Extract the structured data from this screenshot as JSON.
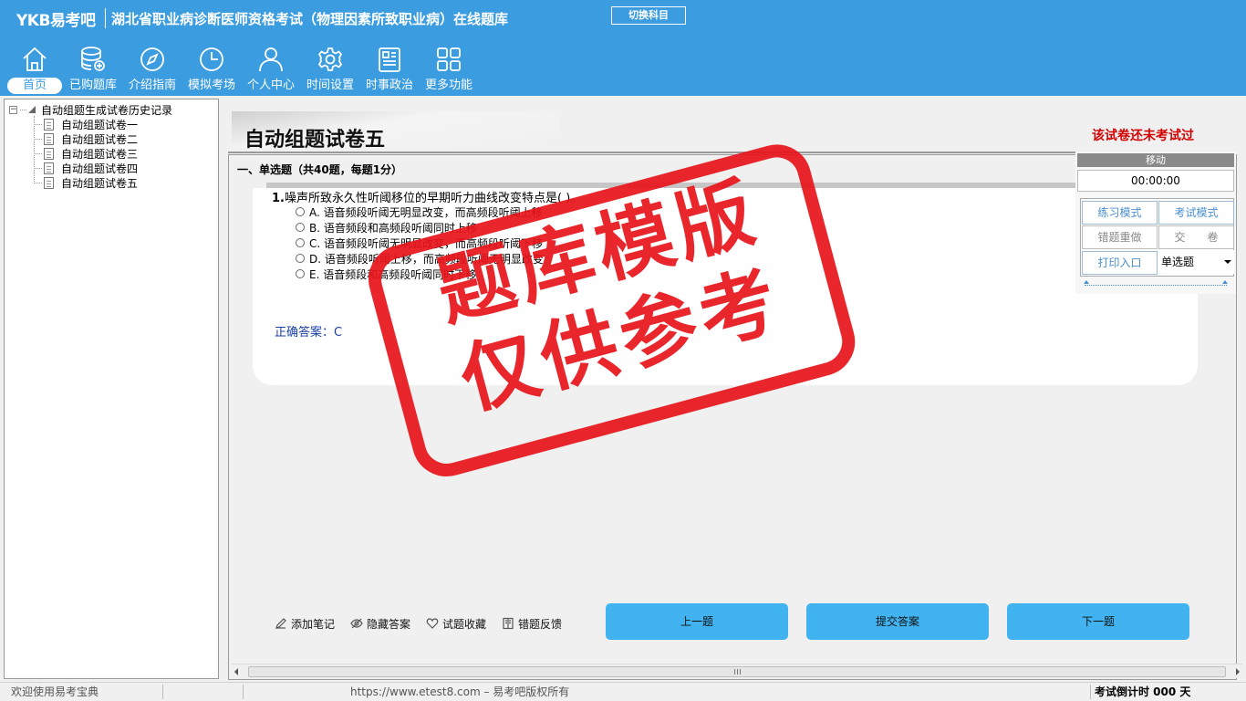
{
  "header": {
    "logo": "YKB易考吧",
    "title": "湖北省职业病诊断医师资格考试（物理因素所致职业病）在线题库",
    "switch_label": "切换科目"
  },
  "nav": [
    {
      "label": "首页",
      "icon": "home-icon"
    },
    {
      "label": "已购题库",
      "icon": "database-icon"
    },
    {
      "label": "介绍指南",
      "icon": "compass-icon"
    },
    {
      "label": "模拟考场",
      "icon": "clock-icon"
    },
    {
      "label": "个人中心",
      "icon": "user-icon"
    },
    {
      "label": "时间设置",
      "icon": "gear-icon"
    },
    {
      "label": "时事政治",
      "icon": "newspaper-icon"
    },
    {
      "label": "更多功能",
      "icon": "grid-icon"
    }
  ],
  "tree": {
    "root": "自动组题生成试卷历史记录",
    "items": [
      "自动组题试卷一",
      "自动组题试卷二",
      "自动组题试卷三",
      "自动组题试卷四",
      "自动组题试卷五"
    ]
  },
  "paper": {
    "title": "自动组题试卷五",
    "status": "该试卷还未考试过",
    "section": "一、单选题（共40题，每题1分）"
  },
  "question": {
    "number": "1.",
    "stem": "噪声所致永久性听阈移位的早期听力曲线改变特点是( )。",
    "options": [
      "A. 语音频段听阈无明显改变，而高频段听阈上移",
      "B. 语音频段和高频段听阈同时上移",
      "C. 语音频段听阈无明显改变，而高频段听阈下移",
      "D. 语音频段听阈上移，而高频段听阈无明显改变",
      "E. 语音频段和高频段听阈同时下移"
    ],
    "answer": "正确答案：C"
  },
  "control": {
    "move": "移动",
    "timer": "00:00:00",
    "practice": "练习模式",
    "exam": "考试模式",
    "redo": "错题重做",
    "submit": "交　　卷",
    "print": "打印入口",
    "type_select": "单选题"
  },
  "tools": {
    "note": "添加笔记",
    "hide": "隐藏答案",
    "fav": "试题收藏",
    "feedback": "错题反馈"
  },
  "actions": {
    "prev": "上一题",
    "submit": "提交答案",
    "next": "下一题"
  },
  "statusbar": {
    "welcome": "欢迎使用易考宝典",
    "site": "https://www.etest8.com – 易考吧版权所有",
    "countdown": "考试倒计时 000 天"
  },
  "watermark": {
    "line1": "题库模版",
    "line2": "仅供参考"
  },
  "colors": {
    "header": "#3b9de0",
    "primary_button": "#40b3f0",
    "stamp": "#e8141b",
    "status_red": "#d40000"
  }
}
